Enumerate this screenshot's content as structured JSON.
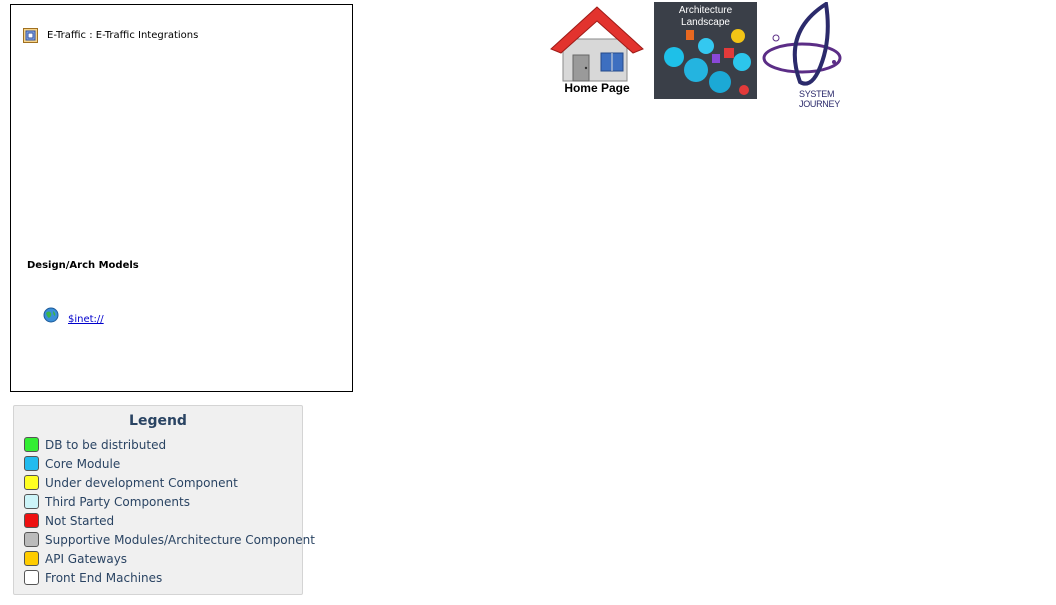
{
  "diagram": {
    "title": "E-Traffic : E-Traffic Integrations",
    "section_heading": "Design/Arch Models",
    "link_label": "$inet://"
  },
  "legend": {
    "title": "Legend",
    "items": [
      {
        "label": "DB to be distributed",
        "color": "#33ee33"
      },
      {
        "label": "Core Module",
        "color": "#22bbee"
      },
      {
        "label": "Under development Component",
        "color": "#ffff22"
      },
      {
        "label": "Third Party Components",
        "color": "#ccf4f8"
      },
      {
        "label": "Not Started",
        "color": "#ee1111"
      },
      {
        "label": "Supportive Modules/Architecture Component",
        "color": "#bbbbbb"
      },
      {
        "label": "API Gateways",
        "color": "#ffcc00"
      },
      {
        "label": "Front End Machines",
        "color": "#ffffff"
      }
    ]
  },
  "nav": {
    "home_label": "Home Page",
    "arch_label": "Architecture Landscape",
    "journey_label": "SYSTEM JOURNEY"
  }
}
